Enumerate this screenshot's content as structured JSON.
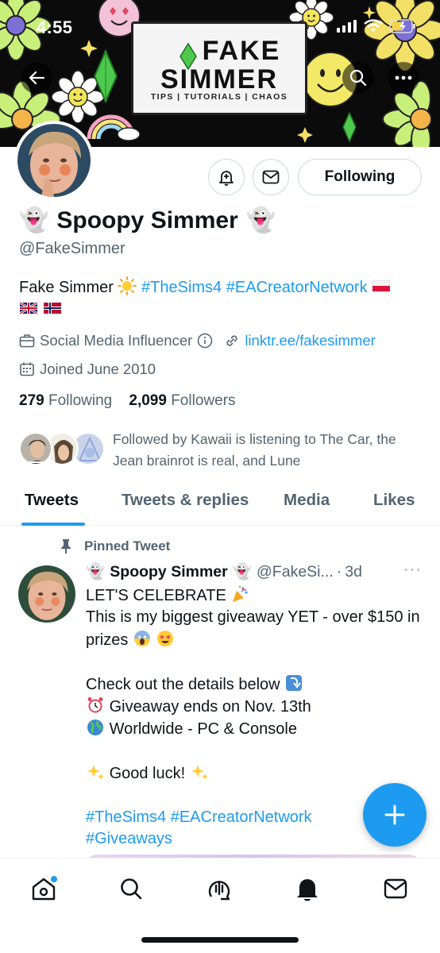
{
  "status_bar": {
    "time": "4:55"
  },
  "banner": {
    "brand_line1": "FAKE",
    "brand_line2": "SIMMER",
    "tagline": "TIPS | TUTORIALS | CHAOS"
  },
  "profile": {
    "display_name": "Spoopy Simmer",
    "name_emoji": "👻",
    "handle": "@FakeSimmer",
    "following_button": "Following",
    "bio": {
      "text": "Fake Simmer",
      "tag1": "#TheSims4",
      "tag2": "#EACreatorNetwork"
    },
    "category": "Social Media Influencer",
    "link": "linktr.ee/fakesimmer",
    "joined": "Joined June 2010",
    "following_count": "279",
    "following_label": "Following",
    "followers_count": "2,099",
    "followers_label": "Followers",
    "followed_by": "Followed by Kawaii is listening to The Car, the Jean brainrot is real, and Lune"
  },
  "tabs": {
    "tweets": "Tweets",
    "replies": "Tweets & replies",
    "media": "Media",
    "likes": "Likes"
  },
  "tweet": {
    "pinned_label": "Pinned Tweet",
    "name": "Spoopy Simmer",
    "handle": "@FakeSi...",
    "time": "3d",
    "more": "···",
    "line1": "LET'S CELEBRATE",
    "line2": "This is my biggest giveaway YET - over $150 in prizes",
    "line3": "Check out the details below",
    "line4": "Giveaway ends on Nov. 13th",
    "line5": "Worldwide - PC & Console",
    "line6": "Good luck!",
    "tag1": "#TheSims4",
    "tag2": "#EACreatorNetwork",
    "tag3": "#Giveaways"
  },
  "icons": [
    "back-arrow-icon",
    "search-icon",
    "more-icon",
    "bell-plus-icon",
    "mail-icon",
    "briefcase-icon",
    "info-icon",
    "link-icon",
    "calendar-icon",
    "pin-icon",
    "compose-plus-icon",
    "home-icon",
    "search-nav-icon",
    "spaces-icon",
    "bell-icon",
    "mail-nav-icon"
  ],
  "colors": {
    "accent": "#1d9bf0",
    "text": "#0f1419",
    "muted": "#536471"
  }
}
